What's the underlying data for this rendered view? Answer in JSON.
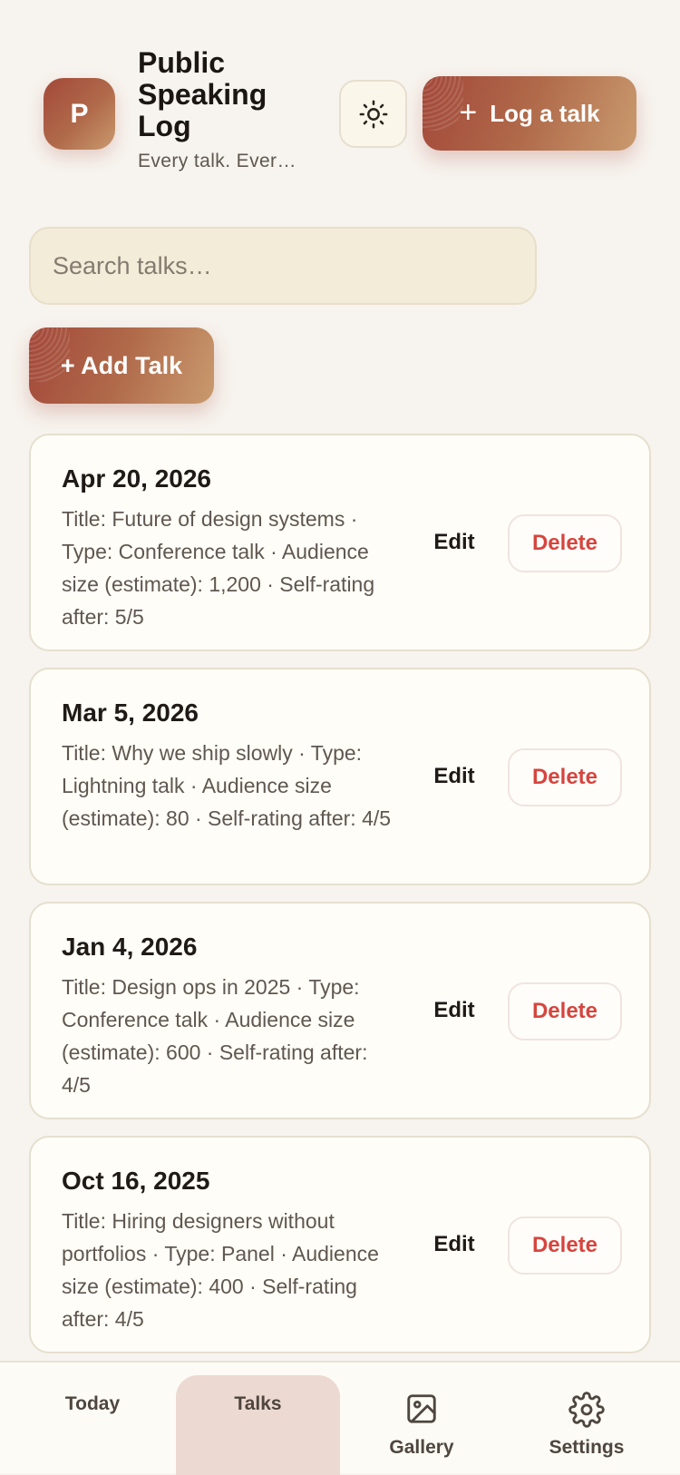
{
  "header": {
    "logo_letter": "P",
    "title": "Public Speaking Log",
    "subtitle": "Every talk. Ever…",
    "theme_icon": "sun-icon",
    "log_button_label": "Log a talk",
    "log_button_icon": "plus-icon"
  },
  "search": {
    "placeholder": "Search talks…",
    "value": ""
  },
  "add_button_label": "+ Add Talk",
  "talks": [
    {
      "date": "Apr 20, 2026",
      "detail": "Title: Future of design systems · Type: Conference talk · Audience size (estimate): 1,200 · Self-rating after: 5/5",
      "edit_label": "Edit",
      "delete_label": "Delete"
    },
    {
      "date": "Mar 5, 2026",
      "detail": "Title: Why we ship slowly · Type: Lightning talk · Audience size (estimate): 80 · Self-rating after: 4/5",
      "edit_label": "Edit",
      "delete_label": "Delete"
    },
    {
      "date": "Jan 4, 2026",
      "detail": "Title: Design ops in 2025 · Type: Conference talk · Audience size (estimate): 600 · Self-rating after: 4/5",
      "edit_label": "Edit",
      "delete_label": "Delete"
    },
    {
      "date": "Oct 16, 2025",
      "detail": "Title: Hiring designers without portfolios · Type: Panel · Audience size (estimate): 400 · Self-rating after: 4/5",
      "edit_label": "Edit",
      "delete_label": "Delete"
    }
  ],
  "nav": {
    "today": "Today",
    "talks": "Talks",
    "gallery": "Gallery",
    "settings": "Settings",
    "active": "talks"
  },
  "colors": {
    "accent_start": "#a3483a",
    "accent_end": "#c99a6e",
    "delete_text": "#d6453f",
    "active_tab_bg": "#ecd9d2"
  }
}
